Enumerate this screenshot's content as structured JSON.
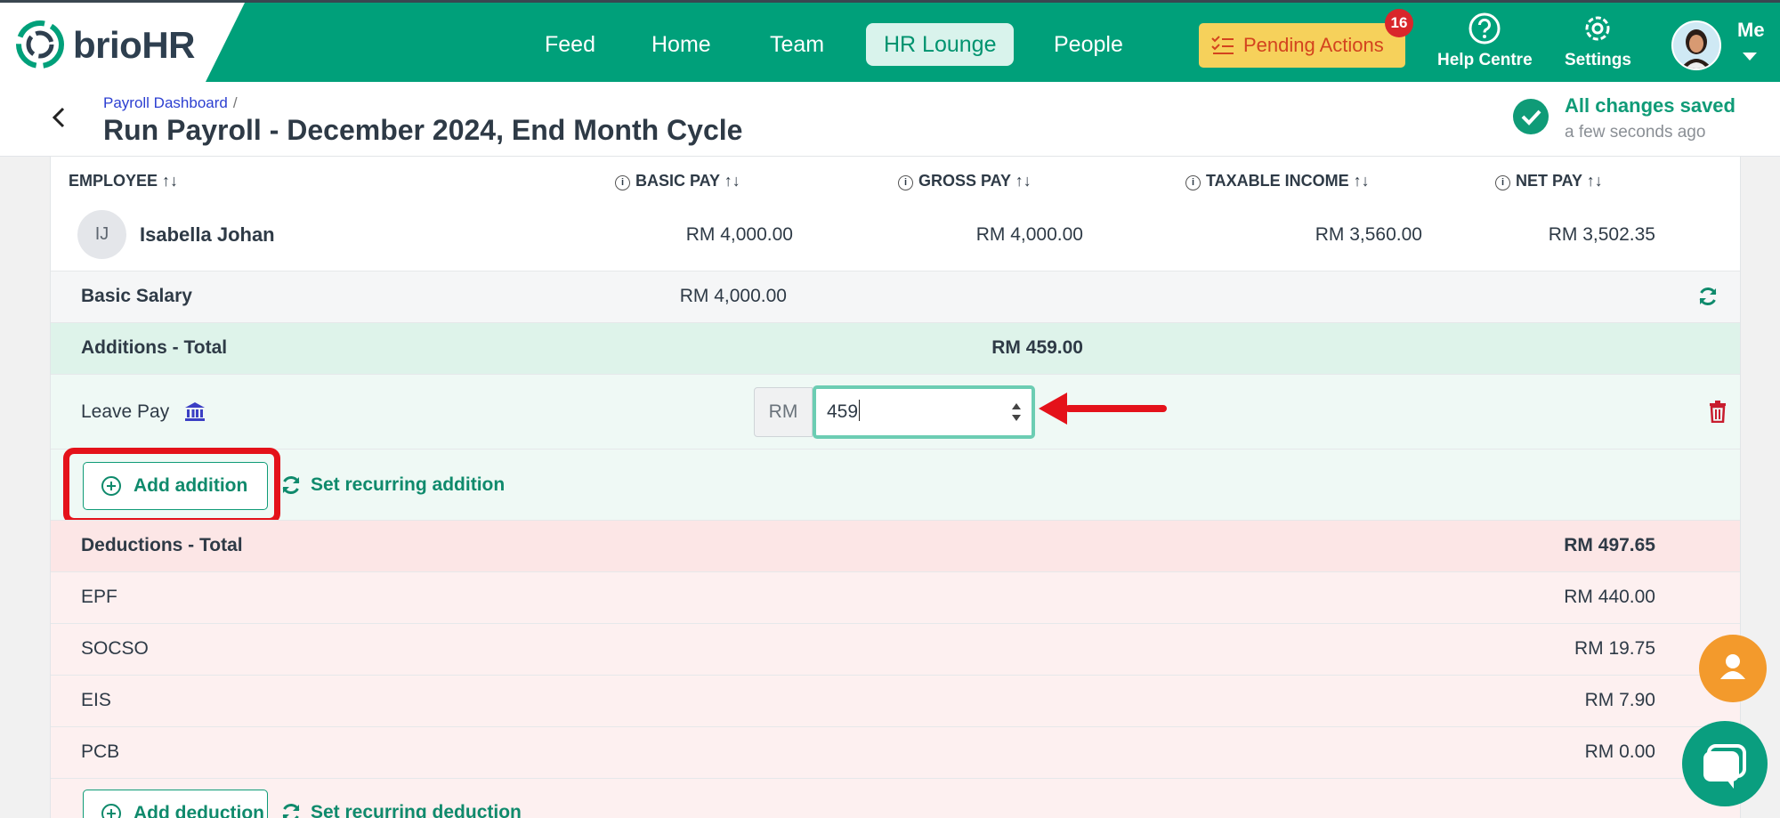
{
  "brand": {
    "name_main": "brio",
    "name_suffix": "HR",
    "color": "#00a07a"
  },
  "nav": {
    "items": [
      {
        "label": "Feed"
      },
      {
        "label": "Home"
      },
      {
        "label": "Team"
      },
      {
        "label": "HR Lounge",
        "active": true
      },
      {
        "label": "People"
      }
    ],
    "pending_label": "Pending Actions",
    "pending_count": "16",
    "help_label": "Help Centre",
    "settings_label": "Settings",
    "me_label": "Me"
  },
  "header": {
    "breadcrumb": "Payroll Dashboard",
    "breadcrumb_sep": "/",
    "title": "Run Payroll - December 2024, End Month Cycle",
    "saved_title": "All changes saved",
    "saved_sub": "a few seconds ago"
  },
  "table": {
    "columns": {
      "employee": "EMPLOYEE ↑↓",
      "basic_pay": "BASIC PAY ↑↓",
      "gross_pay": "GROSS PAY ↑↓",
      "taxable_income": "TAXABLE INCOME ↑↓",
      "net_pay": "NET PAY ↑↓"
    },
    "employee": {
      "initials": "IJ",
      "name": "Isabella Johan",
      "basic_pay": "RM 4,000.00",
      "gross_pay": "RM 4,000.00",
      "taxable_income": "RM 3,560.00",
      "net_pay": "RM 3,502.35"
    }
  },
  "details": {
    "basic_salary_label": "Basic Salary",
    "basic_salary_value": "RM 4,000.00",
    "additions_total_label": "Additions - Total",
    "additions_total_value": "RM 459.00",
    "leave_pay_label": "Leave Pay",
    "currency_prefix": "RM",
    "leave_pay_input": "459",
    "add_addition_label": "Add addition",
    "set_recurring_addition_label": "Set recurring addition",
    "deductions_total_label": "Deductions - Total",
    "deductions_total_value": "RM 497.65",
    "deductions": [
      {
        "label": "EPF",
        "value": "RM 440.00"
      },
      {
        "label": "SOCSO",
        "value": "RM 19.75"
      },
      {
        "label": "EIS",
        "value": "RM 7.90"
      },
      {
        "label": "PCB",
        "value": "RM 0.00"
      }
    ],
    "add_deduction_label": "Add deduction",
    "set_recurring_deduction_label": "Set recurring deduction"
  },
  "colors": {
    "accent": "#0f9b77",
    "additions_bg": "#def3ea",
    "deductions_bg": "#fce6e6",
    "annotation_red": "#e4121a"
  }
}
